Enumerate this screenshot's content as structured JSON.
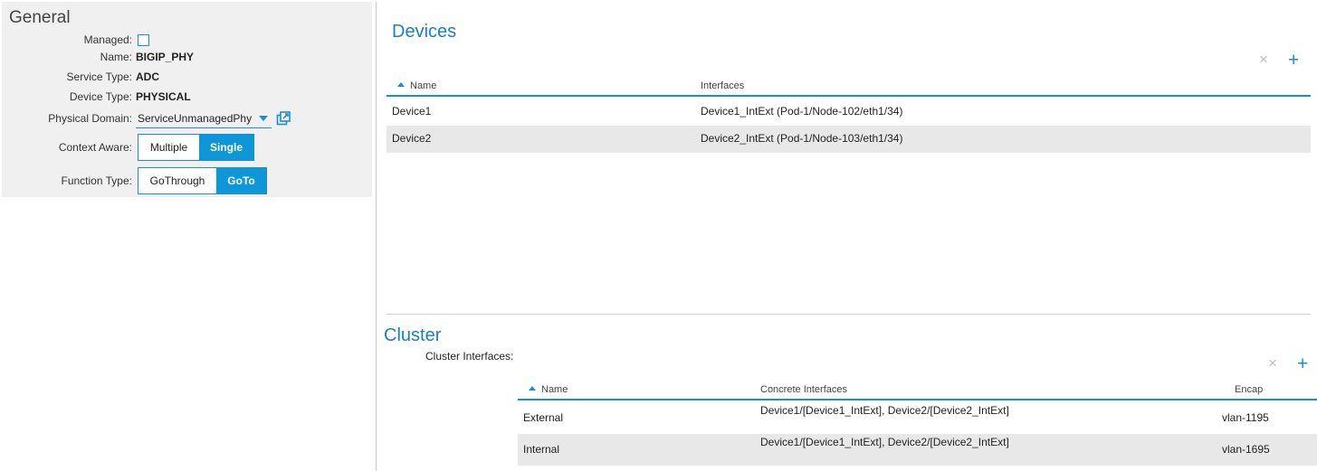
{
  "general": {
    "title": "General",
    "managed_label": "Managed:",
    "managed_checked": false,
    "name_label": "Name:",
    "name_value": "BIGIP_PHY",
    "service_type_label": "Service Type:",
    "service_type_value": "ADC",
    "device_type_label": "Device Type:",
    "device_type_value": "PHYSICAL",
    "physical_domain_label": "Physical Domain:",
    "physical_domain_value": "ServiceUnmanagedPhy",
    "context_aware_label": "Context Aware:",
    "context_aware_options": [
      "Multiple",
      "Single"
    ],
    "context_aware_selected": "Single",
    "function_type_label": "Function Type:",
    "function_type_options": [
      "GoThrough",
      "GoTo"
    ],
    "function_type_selected": "GoTo"
  },
  "devices": {
    "title": "Devices",
    "columns": [
      "Name",
      "Interfaces"
    ],
    "rows": [
      {
        "name": "Device1",
        "interfaces": "Device1_IntExt (Pod-1/Node-102/eth1/34)"
      },
      {
        "name": "Device2",
        "interfaces": "Device2_IntExt (Pod-1/Node-103/eth1/34)"
      }
    ]
  },
  "cluster": {
    "title": "Cluster",
    "interfaces_label": "Cluster Interfaces:",
    "columns": [
      "Name",
      "Concrete Interfaces",
      "Encap"
    ],
    "rows": [
      {
        "name": "External",
        "concrete": "Device1/[Device1_IntExt], Device2/[Device2_IntExt]",
        "encap": "vlan-1195"
      },
      {
        "name": "Internal",
        "concrete": "Device1/[Device1_IntExt], Device2/[Device2_IntExt]",
        "encap": "vlan-1695"
      }
    ]
  },
  "toolbar": {
    "delete_icon": "×",
    "add_icon": "+"
  },
  "colors": {
    "accent": "#0d97d8",
    "title": "#1a7fbf",
    "panel_bg": "#f0f0f0",
    "row_alt": "#e8e8e8"
  },
  "icons": {
    "sort": "sort-ascending-icon",
    "external": "open-external-icon",
    "dropdown": "chevron-down-icon"
  }
}
